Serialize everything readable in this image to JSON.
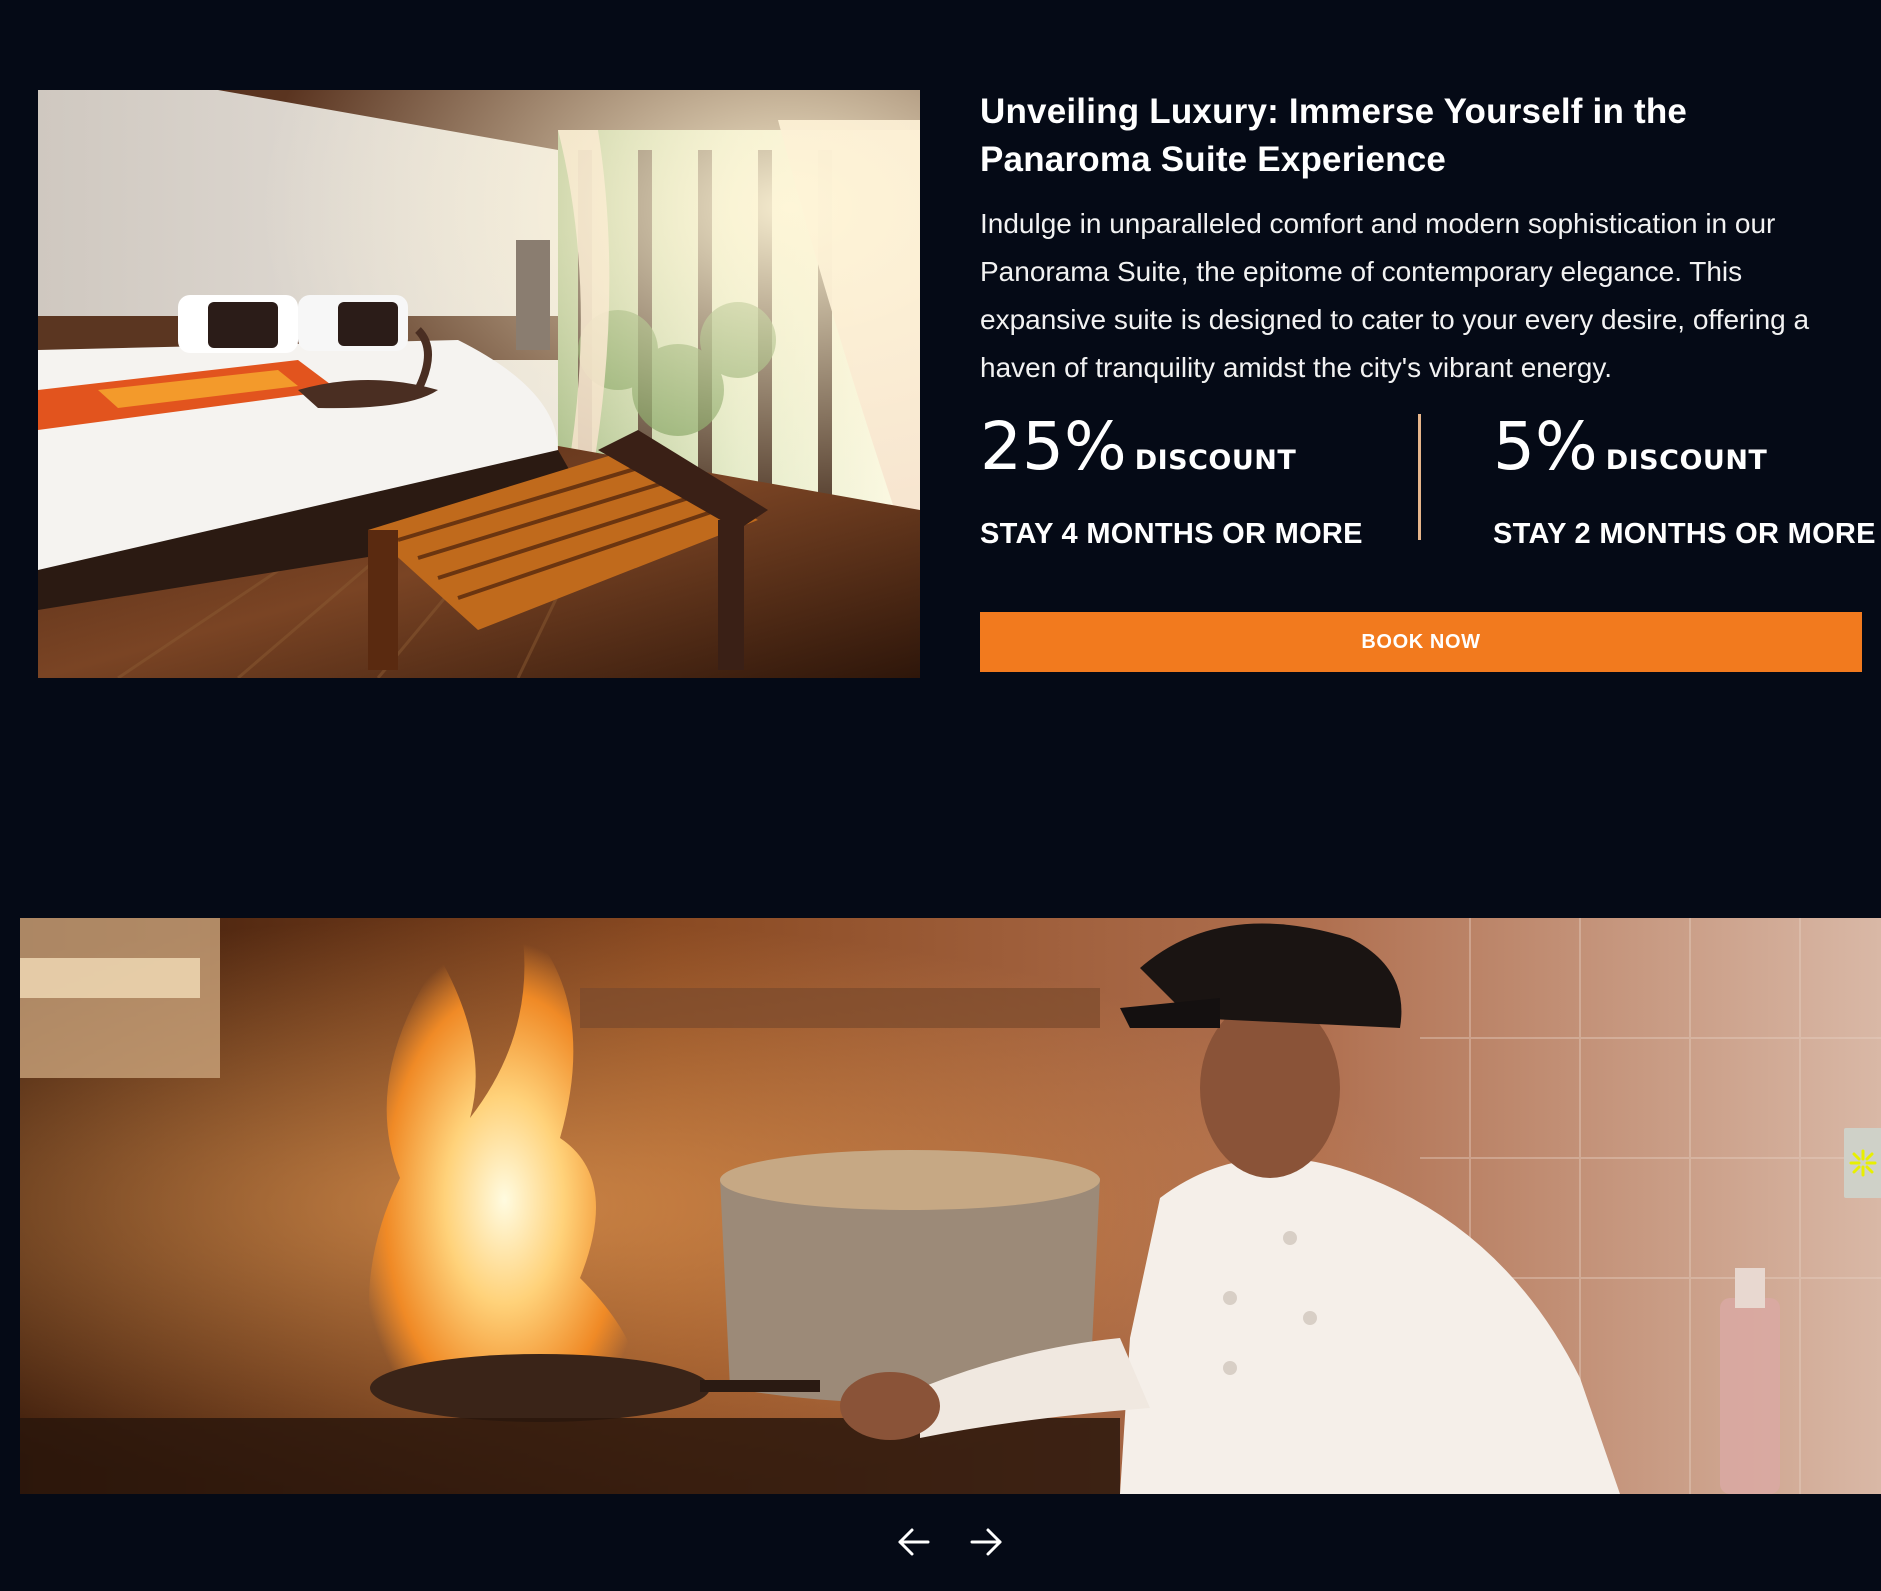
{
  "suite": {
    "image_alt": "Panorama suite bedroom",
    "title": "Unveiling Luxury: Immerse Yourself in the Panaroma Suite Experience",
    "description": "Indulge in unparalleled comfort and modern sophistication in our Panorama Suite, the epitome of contemporary elegance. This expansive suite is designed to cater to your every desire, offering a haven of tranquility amidst the city's vibrant energy.",
    "offers": [
      {
        "percent": "25%",
        "label": "DISCOUNT",
        "condition": "STAY 4 MONTHS OR MORE"
      },
      {
        "percent": "5%",
        "label": "DISCOUNT",
        "condition": "STAY 2 MONTHS OR MORE"
      }
    ],
    "book_label": "BOOK NOW"
  },
  "slider": {
    "image_alt": "Chef flambéing in the kitchen",
    "prev_icon": "arrow-left-icon",
    "next_icon": "arrow-right-icon"
  },
  "widget": {
    "icon": "spark-icon"
  },
  "colors": {
    "background": "#050a16",
    "accent": "#f27a1e",
    "divider": "#e6b58a",
    "text": "#ffffff"
  }
}
